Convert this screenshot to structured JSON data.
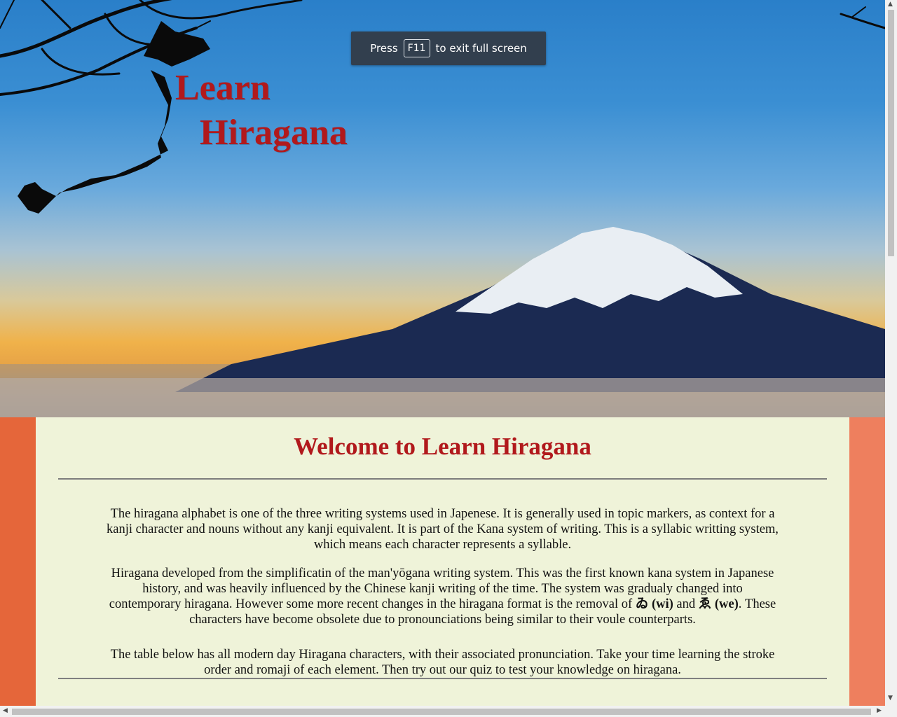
{
  "hero": {
    "title_line1": "Learn",
    "title_line2": "Hiragana"
  },
  "fullscreen_toast": {
    "prefix": "Press",
    "key": "F11",
    "suffix": "to exit full screen"
  },
  "main": {
    "heading": "Welcome to Learn Hiragana",
    "paragraph1": "The hiragana alphabet is one of the three writing systems used in Japenese. It is generally used in topic markers, as context for a kanji character and nouns without any kanji equivalent. It is part of the Kana system of writing. This is a syllabic writting system, which means each character represents a syllable.",
    "paragraph2_start": "Hiragana developed from the simplificatin of the man'yōgana writing system. This was the first known kana system in Japanese history, and was heavily influenced by the Chinese kanji writing of the time. The system was gradualy changed into contemporary hiragana. However some more recent changes in the hiragana format is the removal of",
    "char_wi": "ゐ (wi)",
    "and": "and",
    "char_we": "ゑ (we)",
    "paragraph2_end": ". These characters have become obsolete due to pronounciations being similar to their voule counterparts.",
    "paragraph3": "The table below has all modern day Hiragana characters, with their associated pronunciation. Take your time learning the stroke order and romaji of each element. Then try out our quiz to test your knowledge on hiragana."
  },
  "colors": {
    "accent_red": "#b1191c",
    "content_bg": "#eff3d9",
    "side_left": "#e5663a",
    "side_right": "#ee7f5e"
  }
}
